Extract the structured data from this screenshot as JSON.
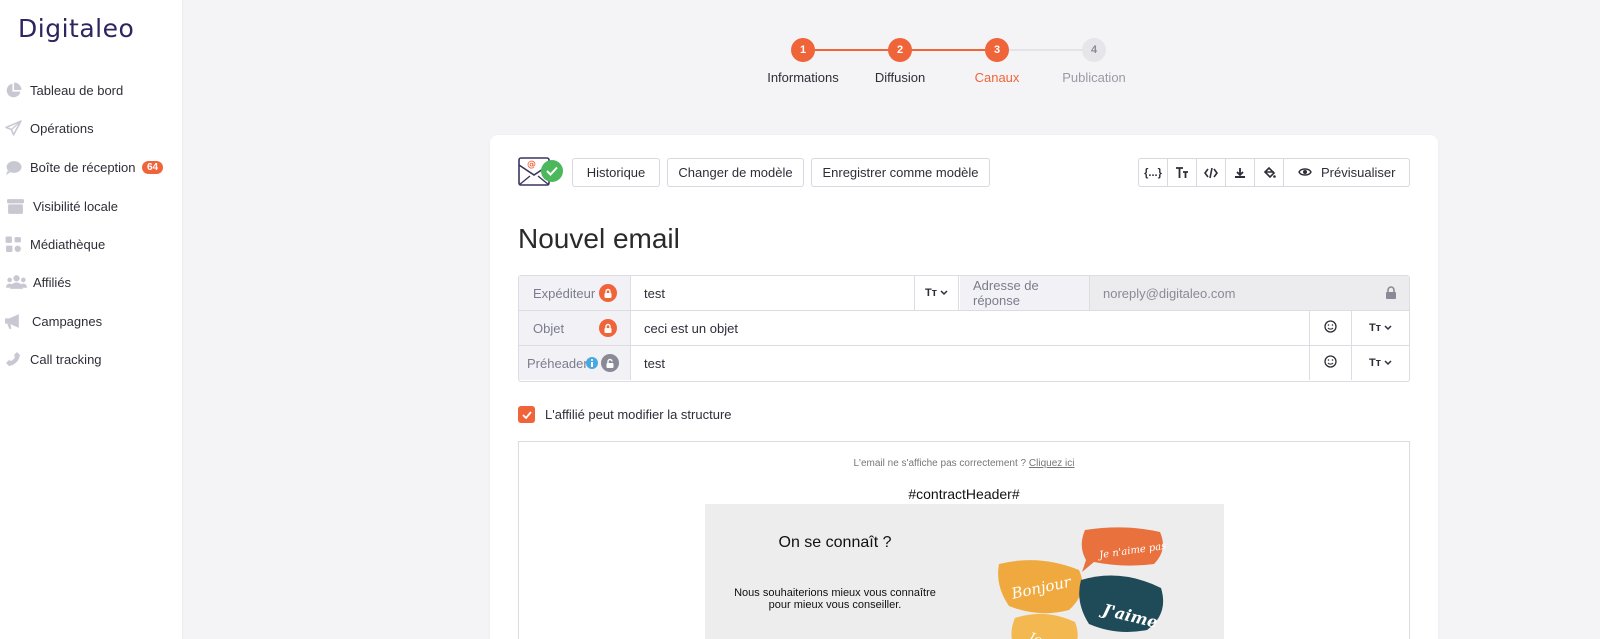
{
  "brand": {
    "logo_text": "Digitaleo",
    "accent": "#f0643a"
  },
  "sidebar": {
    "items": [
      {
        "label": "Tableau de bord",
        "icon": "pie-chart-icon"
      },
      {
        "label": "Opérations",
        "icon": "paper-plane-icon"
      },
      {
        "label": "Boîte de réception",
        "icon": "chat-bubble-icon",
        "badge": "64"
      },
      {
        "label": "Visibilité locale",
        "icon": "storefront-icon"
      },
      {
        "label": "Médiathèque",
        "icon": "images-icon"
      },
      {
        "label": "Affiliés",
        "icon": "users-icon"
      },
      {
        "label": "Campagnes",
        "icon": "megaphone-icon"
      },
      {
        "label": "Call tracking",
        "icon": "phone-icon"
      }
    ]
  },
  "stepper": {
    "steps": [
      {
        "num": "1",
        "label": "Informations",
        "state": "done"
      },
      {
        "num": "2",
        "label": "Diffusion",
        "state": "done"
      },
      {
        "num": "3",
        "label": "Canaux",
        "state": "active"
      },
      {
        "num": "4",
        "label": "Publication",
        "state": "todo"
      }
    ]
  },
  "toolbar": {
    "historique": "Historique",
    "changer": "Changer de modèle",
    "enregistrer": "Enregistrer comme modèle",
    "variables": "{...}",
    "preview": "Prévisualiser"
  },
  "editor": {
    "title": "Nouvel email",
    "expediteur_label": "Expéditeur",
    "expediteur_value": "test",
    "reply_label": "Adresse de réponse",
    "reply_placeholder": "noreply@digitaleo.com",
    "objet_label": "Objet",
    "objet_value": "ceci est un objet",
    "preheader_label": "Préheader",
    "preheader_value": "test",
    "text_format_label": "Tт",
    "checkbox_label": "L'affilié peut modifier la structure"
  },
  "email_preview": {
    "notice": "L'email ne s'affiche pas correctement ?",
    "notice_link": "Cliquez ici",
    "header": "#contractHeader#",
    "banner_title": "On se connaît ?",
    "banner_text": "Nous souhaiterions mieux vous connaître pour mieux vous conseiller.",
    "bubbles": [
      "Bonjour",
      "Je n'aime pas",
      "J'aime",
      "Je suis"
    ]
  }
}
